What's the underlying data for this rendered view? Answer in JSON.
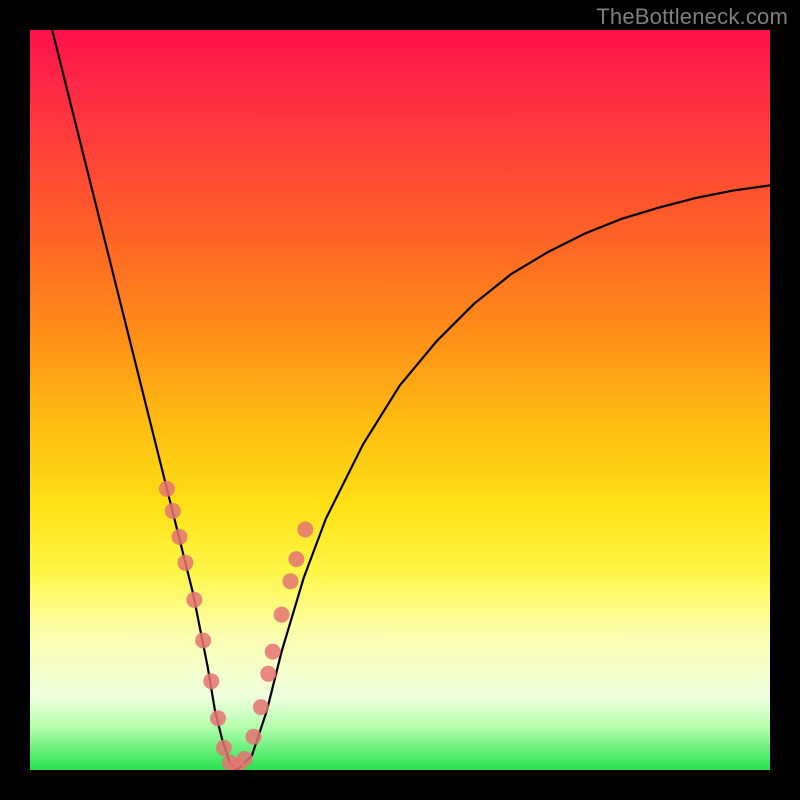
{
  "watermark_text": "TheBottleneck.com",
  "chart_data": {
    "type": "line",
    "title": "",
    "xlabel": "",
    "ylabel": "",
    "xlim": [
      0,
      100
    ],
    "ylim": [
      0,
      100
    ],
    "grid": false,
    "legend": false,
    "annotations": [
      "TheBottleneck.com"
    ],
    "series": [
      {
        "name": "bottleneck-curve",
        "x": [
          3,
          6,
          9,
          12,
          15,
          18,
          20,
          22,
          24,
          25,
          26,
          27,
          28,
          30,
          32,
          34,
          37,
          40,
          45,
          50,
          55,
          60,
          65,
          70,
          75,
          80,
          85,
          90,
          95,
          100
        ],
        "y": [
          100,
          88,
          76,
          64,
          52,
          40,
          32,
          24,
          14,
          8,
          4,
          1,
          0,
          2,
          8,
          16,
          26,
          34,
          44,
          52,
          58,
          63,
          67,
          70,
          72.5,
          74.5,
          76,
          77.3,
          78.3,
          79
        ]
      }
    ],
    "markers": {
      "name": "highlighted-points",
      "color": "#e57373",
      "x": [
        18.5,
        19.3,
        20.2,
        21.0,
        22.2,
        23.4,
        24.5,
        25.4,
        26.2,
        27.0,
        28.0,
        29.0,
        30.2,
        31.2,
        32.2,
        32.8,
        34.0,
        35.2,
        36.0,
        37.2
      ],
      "y": [
        38.0,
        35.0,
        31.5,
        28.0,
        23.0,
        17.5,
        12.0,
        7.0,
        3.0,
        1.0,
        0.5,
        1.5,
        4.5,
        8.5,
        13.0,
        16.0,
        21.0,
        25.5,
        28.5,
        32.5
      ]
    },
    "background_gradient": {
      "direction": "vertical",
      "stops": [
        {
          "pos": 0.0,
          "color": "#ff104a"
        },
        {
          "pos": 0.25,
          "color": "#ff5a2a"
        },
        {
          "pos": 0.52,
          "color": "#ffb812"
        },
        {
          "pos": 0.73,
          "color": "#fff646"
        },
        {
          "pos": 0.9,
          "color": "#efffde"
        },
        {
          "pos": 1.0,
          "color": "#27e24e"
        }
      ]
    }
  }
}
